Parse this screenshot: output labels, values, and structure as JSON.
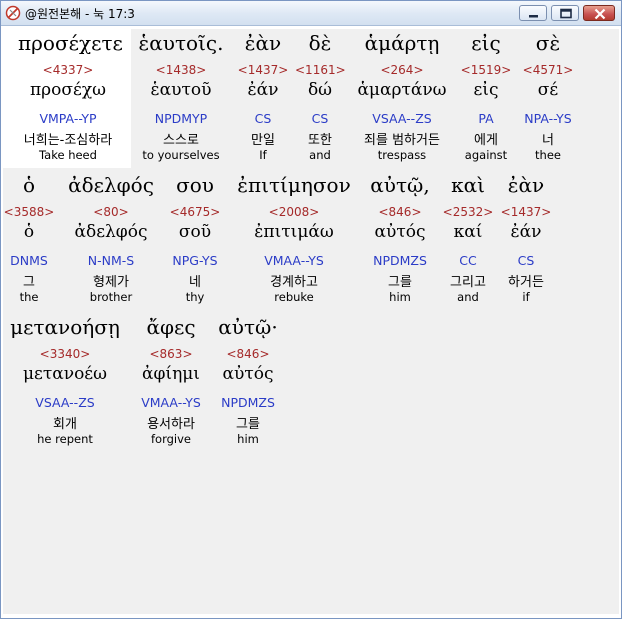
{
  "window": {
    "title": "@원전본해 - 눅 17:3"
  },
  "rows": [
    [
      {
        "greek": "προσέχετε",
        "strong": "<4337>",
        "lemma": "προσέχω",
        "parsing": "VMPA--YP",
        "korean": "너희는-조심하라",
        "english": "Take heed"
      },
      {
        "greek": "ἑαυτοῖς.",
        "strong": "<1438>",
        "lemma": "ἑαυτοῦ",
        "parsing": "NPDMYP",
        "korean": "스스로",
        "english": "to yourselves"
      },
      {
        "greek": "ἐὰν",
        "strong": "<1437>",
        "lemma": "ἐάν",
        "parsing": "CS",
        "korean": "만일",
        "english": "If"
      },
      {
        "greek": "δὲ",
        "strong": "<1161>",
        "lemma": "δώ",
        "parsing": "CS",
        "korean": "또한",
        "english": "and"
      },
      {
        "greek": "ἁμάρτῃ",
        "strong": "<264>",
        "lemma": "ἁμαρτάνω",
        "parsing": "VSAA--ZS",
        "korean": "죄를 범하거든",
        "english": "trespass"
      },
      {
        "greek": "εἰς",
        "strong": "<1519>",
        "lemma": "εἰς",
        "parsing": "PA",
        "korean": "에게",
        "english": "against"
      },
      {
        "greek": "σὲ",
        "strong": "<4571>",
        "lemma": "σέ",
        "parsing": "NPA--YS",
        "korean": "너",
        "english": "thee"
      }
    ],
    [
      {
        "greek": "ὁ",
        "strong": "<3588>",
        "lemma": "ὁ",
        "parsing": "DNMS",
        "korean": "그",
        "english": "the"
      },
      {
        "greek": "ἀδελφός",
        "strong": "<80>",
        "lemma": "ἀδελφός",
        "parsing": "N-NM-S",
        "korean": "형제가",
        "english": "brother"
      },
      {
        "greek": "σου",
        "strong": "<4675>",
        "lemma": "σοῦ",
        "parsing": "NPG-YS",
        "korean": "네",
        "english": "thy"
      },
      {
        "greek": "ἐπιτίμησον",
        "strong": "<2008>",
        "lemma": "ἐπιτιμάω",
        "parsing": "VMAA--YS",
        "korean": "경계하고",
        "english": "rebuke"
      },
      {
        "greek": "αὐτῷ,",
        "strong": "<846>",
        "lemma": "αὐτός",
        "parsing": "NPDMZS",
        "korean": "그를",
        "english": "him"
      },
      {
        "greek": "καὶ",
        "strong": "<2532>",
        "lemma": "καί",
        "parsing": "CC",
        "korean": "그리고",
        "english": "and"
      },
      {
        "greek": "ἐὰν",
        "strong": "<1437>",
        "lemma": "ἐάν",
        "parsing": "CS",
        "korean": "하거든",
        "english": "if"
      }
    ],
    [
      {
        "greek": "μετανοήσῃ",
        "strong": "<3340>",
        "lemma": "μετανοέω",
        "parsing": "VSAA--ZS",
        "korean": "회개",
        "english": "he repent"
      },
      {
        "greek": "ἄφες",
        "strong": "<863>",
        "lemma": "ἀφίημι",
        "parsing": "VMAA--YS",
        "korean": "용서하라",
        "english": "forgive"
      },
      {
        "greek": "αὐτῷ·",
        "strong": "<846>",
        "lemma": "αὐτός",
        "parsing": "NPDMZS",
        "korean": "그를",
        "english": "him"
      }
    ]
  ]
}
